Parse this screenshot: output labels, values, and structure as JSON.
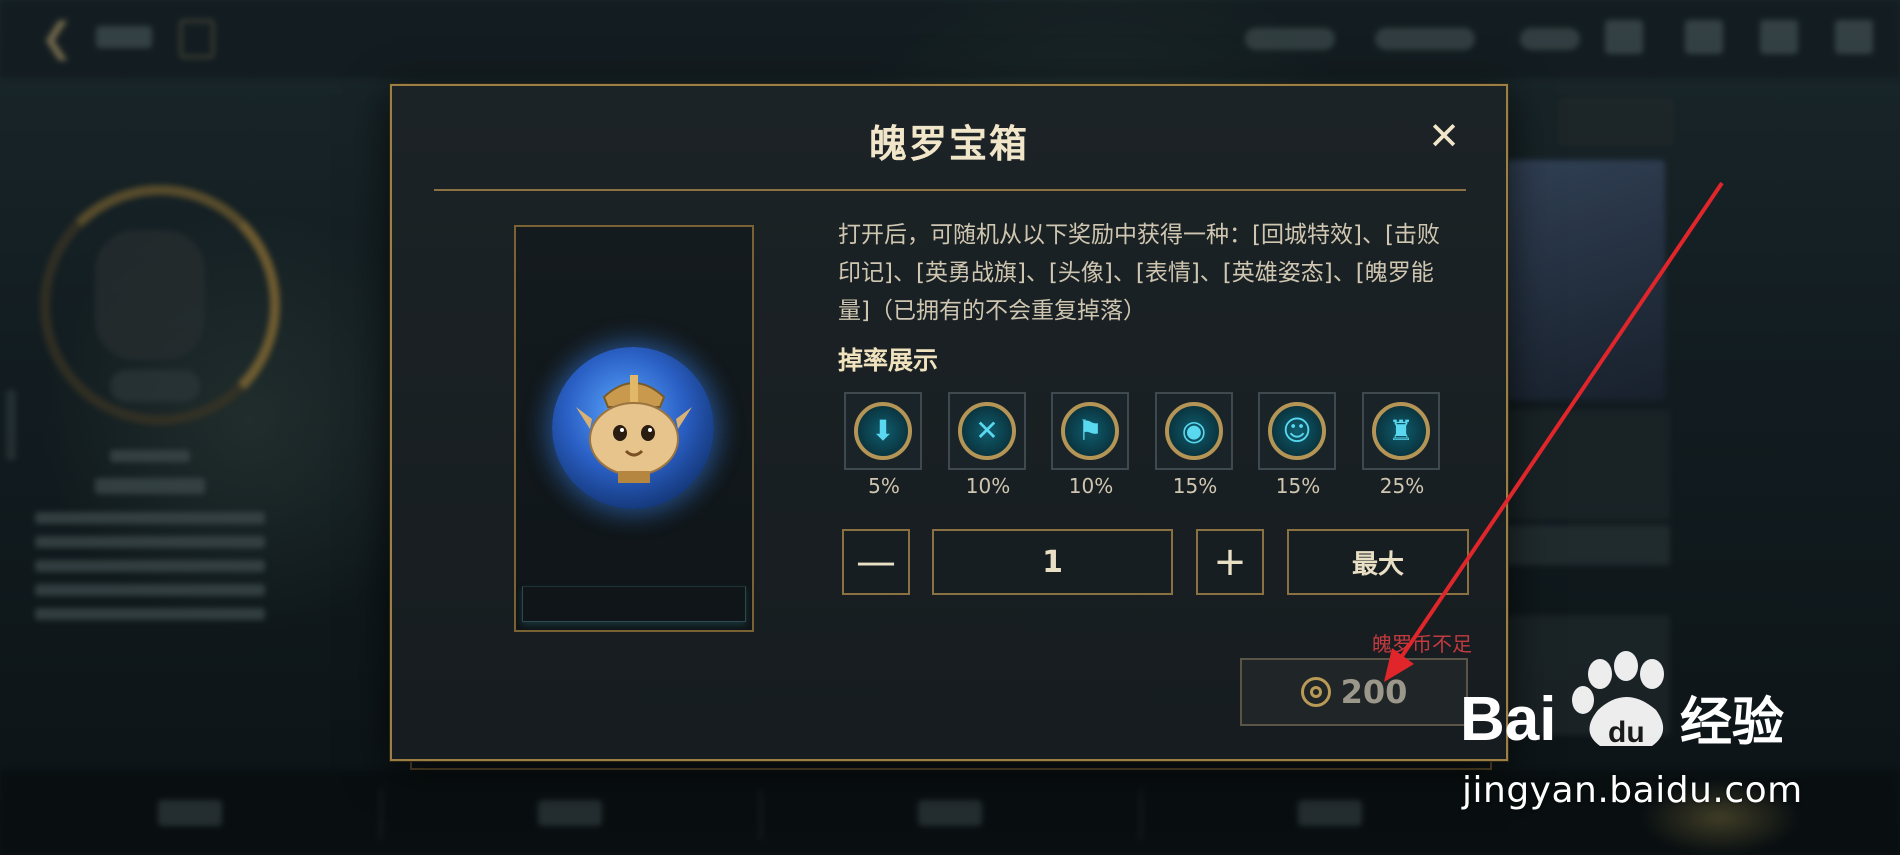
{
  "modal": {
    "title": "魄罗宝箱",
    "close_symbol": "✕",
    "description": "打开后，可随机从以下奖励中获得一种：[回城特效]、[击败印记]、[英勇战旗]、[头像]、[表情]、[英雄姿态]、[魄罗能量]（已拥有的不会重复掉落）",
    "drop_rate_title": "掉率展示",
    "drops": [
      {
        "icon": "recall-effect-icon",
        "glyph": "⬇",
        "rate": "5%"
      },
      {
        "icon": "kill-mark-icon",
        "glyph": "✕",
        "rate": "10%"
      },
      {
        "icon": "banner-icon",
        "glyph": "⚑",
        "rate": "10%"
      },
      {
        "icon": "avatar-icon",
        "glyph": "◉",
        "rate": "15%"
      },
      {
        "icon": "emote-icon",
        "glyph": "☺",
        "rate": "15%"
      },
      {
        "icon": "hero-pose-icon",
        "glyph": "♜",
        "rate": "25%"
      }
    ],
    "quantity": {
      "minus": "—",
      "value": "1",
      "plus": "+",
      "max_label": "最大"
    },
    "insufficient_text": "魄罗币不足",
    "buy": {
      "currency_icon": "poro-coin-icon",
      "price": "200"
    }
  },
  "watermark": {
    "brand_left": "Bai",
    "brand_right": "经验",
    "url": "jingyan.baidu.com"
  },
  "colors": {
    "gold_border": "#9c7f45",
    "title_text": "#f1e6c9",
    "warning_red": "#c23a3f",
    "teal_icon": "#59d8ef"
  }
}
